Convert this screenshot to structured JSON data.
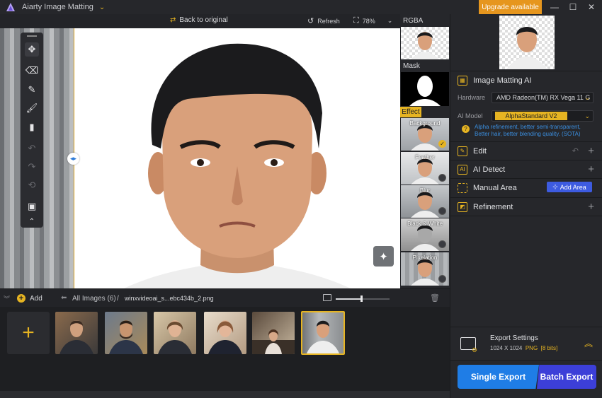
{
  "window": {
    "title": "Aiarty Image Matting",
    "upgrade_label": "Upgrade available",
    "minimize": "—",
    "maximize": "☐",
    "close": "✕"
  },
  "canvas_toolbar": {
    "back_to_original": "Back to original",
    "refresh": "Refresh",
    "zoom": "78%"
  },
  "strip": {
    "rgba_label": "RGBA",
    "mask_label": "Mask",
    "effect_tag": "Effect",
    "effects": [
      {
        "label": "Background",
        "selected": true
      },
      {
        "label": "Feather",
        "selected": false
      },
      {
        "label": "Blur",
        "selected": false
      },
      {
        "label": "Black & White",
        "selected": false
      },
      {
        "label": "Pixelation",
        "selected": false
      }
    ]
  },
  "panel": {
    "matting_title": "Image Matting AI",
    "hardware_label": "Hardware",
    "hardware_value": "AMD Radeon(TM) RX Vega 11 G",
    "model_label": "AI Model",
    "model_value": "AlphaStandard  V2",
    "hint": "Alpha refinement, better semi-transparent, Better hair, better blending quality. (SOTA)",
    "sections": {
      "edit": "Edit",
      "ai_detect": "AI Detect",
      "manual_area": "Manual Area",
      "add_area": "Add Area",
      "refinement": "Refinement"
    },
    "export": {
      "title": "Export Settings",
      "size": "1024 X 1024",
      "format": "PNG",
      "bits": "[8 bits]",
      "single": "Single Export",
      "batch": "Batch Export"
    }
  },
  "gallery": {
    "add_label": "Add",
    "all_images": "All Images (6)",
    "separator": "/",
    "file_name": "winxvideoai_s...ebc434b_2.png",
    "thumb_size_percent": 48,
    "selected_index": 5,
    "thumbnails": [
      "man-in-suit-glasses",
      "man-with-beard-suit",
      "woman-with-glasses-suit",
      "woman-in-suit",
      "woman-in-office",
      "young-man-white-tshirt"
    ]
  },
  "colors": {
    "accent": "#e6b422",
    "blue": "#1f7de6",
    "indigo": "#3c3fd8",
    "panel": "#26272b"
  }
}
